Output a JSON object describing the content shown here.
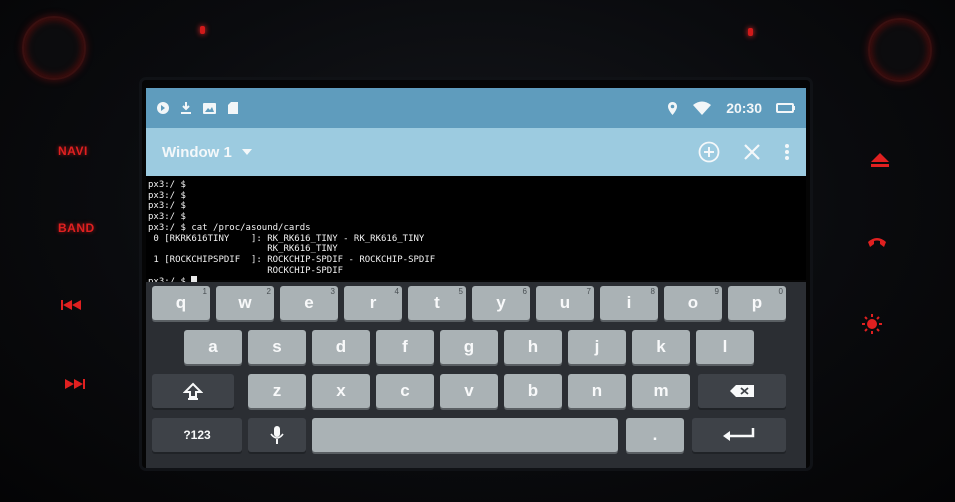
{
  "head_unit": {
    "buttons_left": [
      {
        "label": "NAVI"
      },
      {
        "label": "BAND"
      },
      {
        "icon": "previous-track-icon"
      },
      {
        "icon": "next-track-icon"
      }
    ],
    "buttons_right": [
      {
        "icon": "eject-icon"
      },
      {
        "icon": "phone-hangup-icon"
      },
      {
        "icon": "settings-sun-icon"
      }
    ],
    "accent_color": "#e02020"
  },
  "statusbar": {
    "left_icons": [
      "notification-icon",
      "download-icon",
      "image-icon",
      "sd-card-icon"
    ],
    "right_icons": [
      "location-icon",
      "wifi-icon",
      "battery-icon"
    ],
    "time": "20:30",
    "color": "#5f9cbd"
  },
  "appbar": {
    "title": "Window 1",
    "actions": [
      "add-window-icon",
      "close-icon",
      "more-options-icon"
    ],
    "color": "#9ccbe0"
  },
  "terminal": {
    "lines": [
      "px3:/ $",
      "px3:/ $",
      "px3:/ $",
      "px3:/ $",
      "px3:/ $ cat /proc/asound/cards",
      " 0 [RKRK616TINY    ]: RK_RK616_TINY - RK_RK616_TINY",
      "                      RK_RK616_TINY",
      " 1 [ROCKCHIPSPDIF  ]: ROCKCHIP-SPDIF - ROCKCHIP-SPDIF",
      "                      ROCKCHIP-SPDIF"
    ],
    "prompt": "px3:/ $ "
  },
  "keyboard": {
    "row1": [
      {
        "label": "q",
        "hint": "1"
      },
      {
        "label": "w",
        "hint": "2"
      },
      {
        "label": "e",
        "hint": "3"
      },
      {
        "label": "r",
        "hint": "4"
      },
      {
        "label": "t",
        "hint": "5"
      },
      {
        "label": "y",
        "hint": "6"
      },
      {
        "label": "u",
        "hint": "7"
      },
      {
        "label": "i",
        "hint": "8"
      },
      {
        "label": "o",
        "hint": "9"
      },
      {
        "label": "p",
        "hint": "0"
      }
    ],
    "row2": [
      "a",
      "s",
      "d",
      "f",
      "g",
      "h",
      "j",
      "k",
      "l"
    ],
    "row3": [
      "z",
      "x",
      "c",
      "v",
      "b",
      "n",
      "m"
    ],
    "symbols_label": "?123",
    "period_label": "."
  }
}
